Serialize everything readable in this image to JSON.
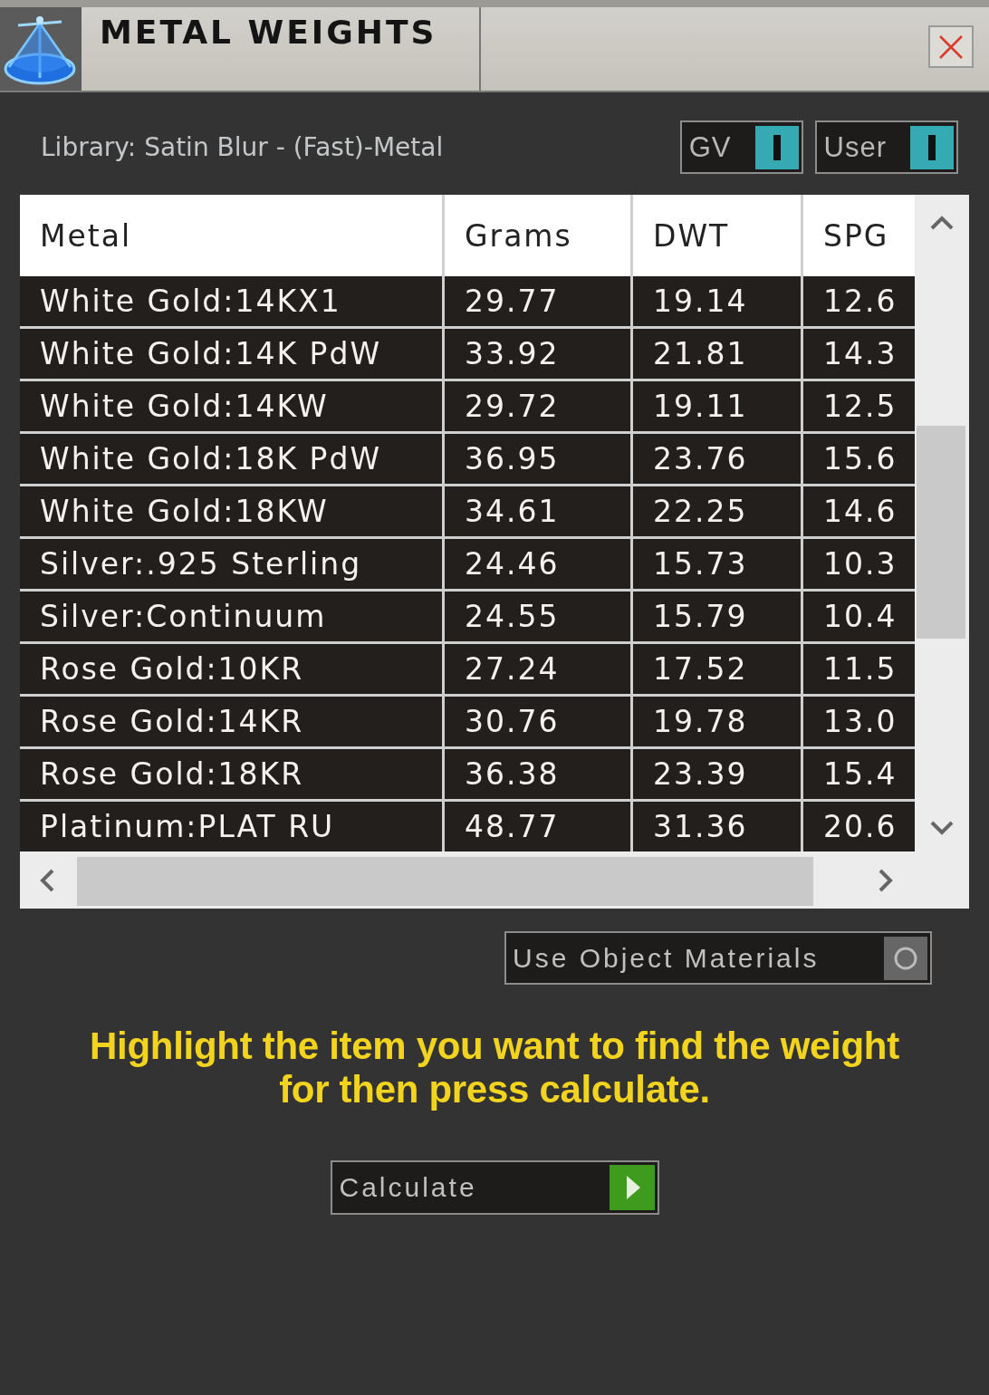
{
  "window": {
    "title": "METAL WEIGHTS"
  },
  "library": "Library: Satin Blur - (Fast)-Metal",
  "toggles": [
    {
      "label": "GV",
      "on": true
    },
    {
      "label": "User",
      "on": true
    }
  ],
  "table": {
    "columns": [
      "Metal",
      "Grams",
      "DWT",
      "SPG"
    ],
    "rows": [
      [
        "White Gold:14KX1",
        "29.77",
        "19.14",
        "12.6"
      ],
      [
        "White Gold:14K PdW",
        "33.92",
        "21.81",
        "14.3"
      ],
      [
        "White Gold:14KW",
        "29.72",
        "19.11",
        "12.5"
      ],
      [
        "White Gold:18K PdW",
        "36.95",
        "23.76",
        "15.6"
      ],
      [
        "White Gold:18KW",
        "34.61",
        "22.25",
        "14.6"
      ],
      [
        "Silver:.925 Sterling",
        "24.46",
        "15.73",
        "10.3"
      ],
      [
        "Silver:Continuum",
        "24.55",
        "15.79",
        "10.4"
      ],
      [
        "Rose Gold:10KR",
        "27.24",
        "17.52",
        "11.5"
      ],
      [
        "Rose Gold:14KR",
        "30.76",
        "19.78",
        "13.0"
      ],
      [
        "Rose Gold:18KR",
        "36.38",
        "23.39",
        "15.4"
      ],
      [
        "Platinum:PLAT RU",
        "48.77",
        "31.36",
        "20.6"
      ]
    ]
  },
  "use_object_materials": {
    "label": "Use Object Materials",
    "on": false
  },
  "instruction": "Highlight the item you want to find the weight for then press calculate.",
  "calculate_button": {
    "label": "Calculate"
  }
}
